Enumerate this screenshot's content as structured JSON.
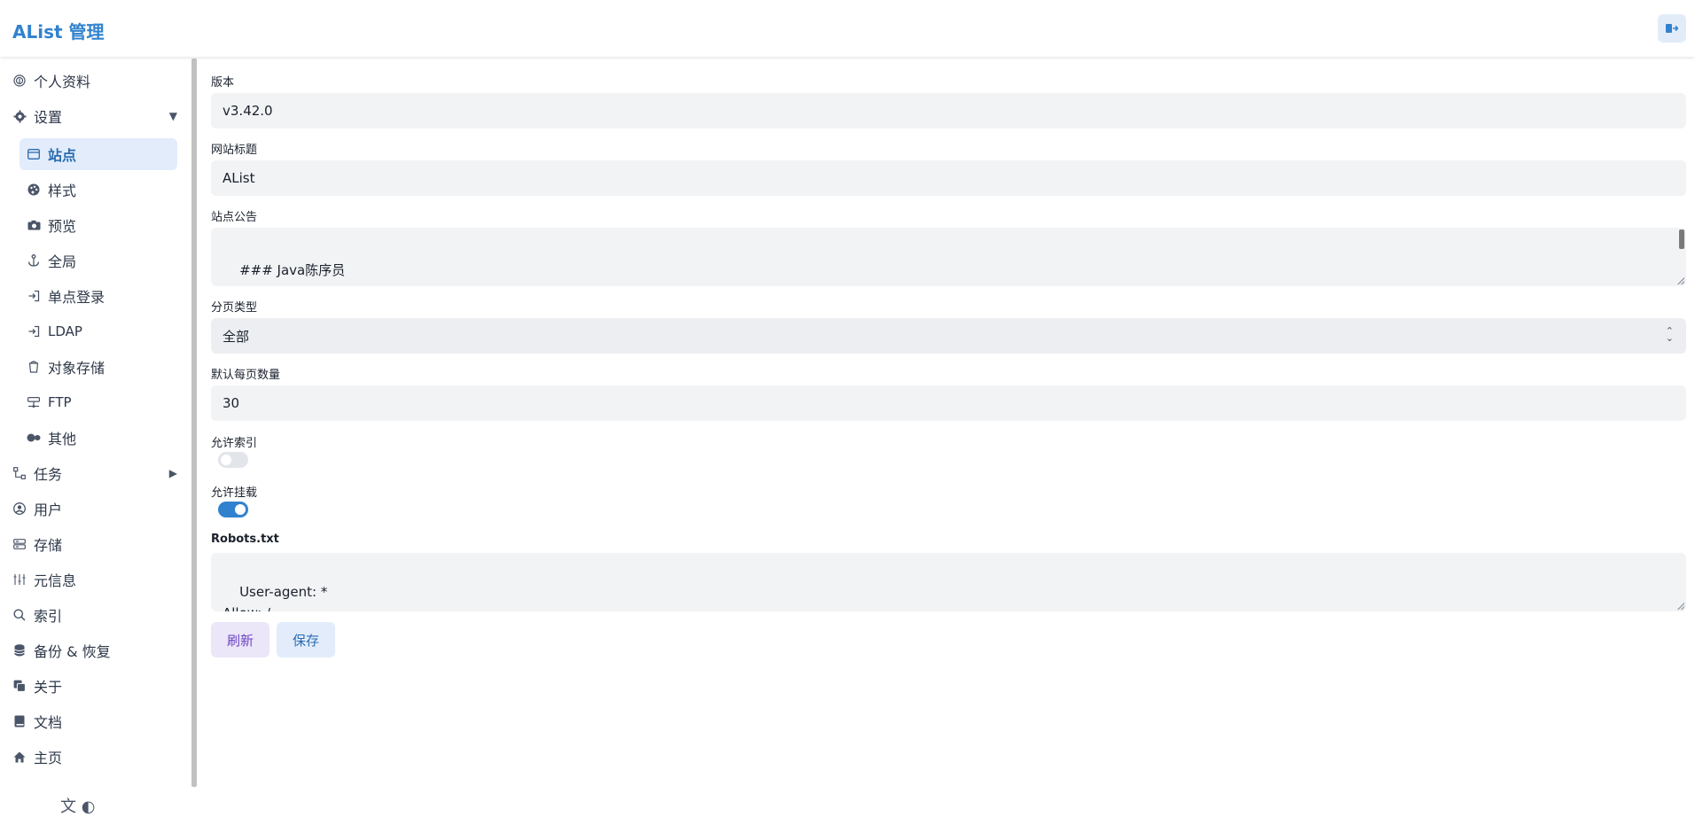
{
  "header": {
    "brand": "AList 管理",
    "logout_icon": "logout-icon"
  },
  "sidebar": {
    "profile": "个人资料",
    "settings": "设置",
    "settings_sub": {
      "site": "站点",
      "style": "样式",
      "preview": "预览",
      "global": "全局",
      "sso": "单点登录",
      "ldap": "LDAP",
      "s3": "对象存储",
      "ftp": "FTP",
      "other": "其他"
    },
    "tasks": "任务",
    "users": "用户",
    "storage": "存储",
    "meta": "元信息",
    "index": "索引",
    "backup": "备份 & 恢复",
    "about": "关于",
    "docs": "文档",
    "home": "主页",
    "footer": "文 ◐"
  },
  "form": {
    "version_label": "版本",
    "version_value": "v3.42.0",
    "site_title_label": "网站标题",
    "site_title_value": "AList",
    "announcement_label": "站点公告",
    "announcement_value": "### Java陈序员\n\n关注微信公众号：【Java陈序员】，获取开源项目分享、AI副业分享、超200本经典计算机电子书籍等。",
    "pagination_label": "分页类型",
    "pagination_value": "全部",
    "default_page_size_label": "默认每页数量",
    "default_page_size_value": "30",
    "allow_indexed_label": "允许索引",
    "allow_indexed": false,
    "allow_mounted_label": "允许挂载",
    "allow_mounted": true,
    "robots_label": "Robots.txt",
    "robots_value": "User-agent: *\nAllow: /",
    "refresh_button": "刷新",
    "save_button": "保存"
  },
  "colors": {
    "accent": "#3182ce",
    "field_bg": "#f2f3f5",
    "active_nav_bg": "#e2ecfb"
  }
}
